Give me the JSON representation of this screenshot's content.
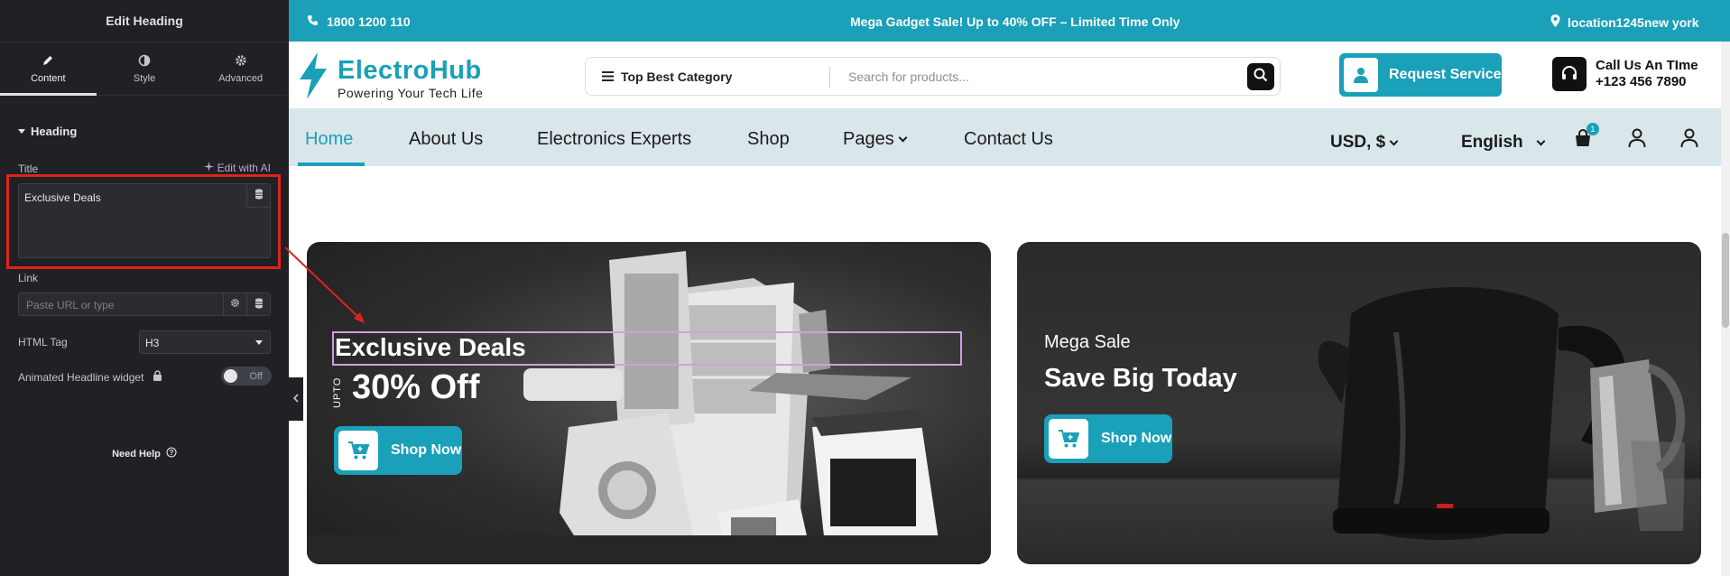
{
  "panel": {
    "title": "Edit Heading",
    "tabs": [
      {
        "label": "Content",
        "icon": "pencil-icon"
      },
      {
        "label": "Style",
        "icon": "half-circle-icon"
      },
      {
        "label": "Advanced",
        "icon": "gear-icon"
      }
    ],
    "section": "Heading",
    "title_label": "Title",
    "ai_link": "Edit with AI",
    "title_value": "Exclusive Deals",
    "link_label": "Link",
    "link_placeholder": "Paste URL or type",
    "html_tag_label": "HTML Tag",
    "html_tag_value": "H3",
    "animated_label": "Animated Headline widget",
    "animated_toggle": "Off",
    "help": "Need Help"
  },
  "site": {
    "topbar": {
      "phone": "1800 1200 110",
      "promo": "Mega Gadget Sale! Up to 40% OFF – Limited Time Only",
      "location": "location1245new york"
    },
    "brand": {
      "name": "ElectroHub",
      "tagline": "Powering Your Tech Life"
    },
    "search": {
      "category": "Top Best Category",
      "placeholder": "Search for products..."
    },
    "request_button": "Request Service",
    "call": {
      "label": "Call Us An TIme",
      "number": "+123 456 7890"
    },
    "nav": {
      "items": [
        "Home",
        "About Us",
        "Electronics Experts",
        "Shop",
        "Pages",
        "Contact Us"
      ],
      "currency": "USD, $",
      "language": "English",
      "cart_count": "1"
    },
    "banner_left": {
      "heading": "Exclusive Deals",
      "upto": "UPTO",
      "discount": "30% Off",
      "button": "Shop Now"
    },
    "banner_right": {
      "kicker": "Mega Sale",
      "heading": "Save Big Today",
      "button": "Shop Now"
    }
  },
  "colors": {
    "accent": "#1aa0b8",
    "panel_bg": "#1f2124",
    "highlight": "#e2231a",
    "nav_bg": "#d9e6ea"
  }
}
